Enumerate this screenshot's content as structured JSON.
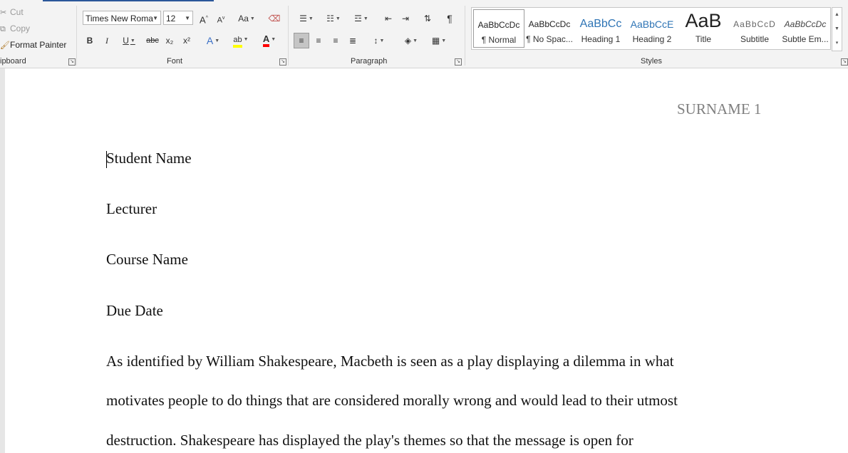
{
  "colors": {
    "accent": "#2b579a",
    "ribbon_bg": "#f3f3f3",
    "heading_blue": "#2e74b5",
    "highlight": "#ffff00",
    "font_color": "#ff0000"
  },
  "clipboard": {
    "cut": "Cut",
    "copy": "Copy",
    "format_painter": "Format Painter",
    "label": "ipboard"
  },
  "font": {
    "name": "Times New Roma",
    "size": "12",
    "label": "Font",
    "grow": "A",
    "shrink": "A",
    "change_case": "Aa",
    "bold": "B",
    "italic": "I",
    "underline": "U",
    "strike": "abc",
    "subscript": "x₂",
    "superscript": "x²",
    "text_effects": "A",
    "highlight": "ab",
    "font_color": "A"
  },
  "paragraph": {
    "label": "Paragraph",
    "show_marks": "¶"
  },
  "styles": {
    "label": "Styles",
    "items": [
      {
        "preview": "AaBbCcDc",
        "name": "¶ Normal"
      },
      {
        "preview": "AaBbCcDc",
        "name": "¶ No Spac..."
      },
      {
        "preview": "AaBbCc",
        "name": "Heading 1"
      },
      {
        "preview": "AaBbCcE",
        "name": "Heading 2"
      },
      {
        "preview": "AaB",
        "name": "Title"
      },
      {
        "preview": "AaBbCcD",
        "name": "Subtitle"
      },
      {
        "preview": "AaBbCcDc",
        "name": "Subtle Em..."
      }
    ]
  },
  "document": {
    "header": "SURNAME 1",
    "lines": [
      "Student Name",
      "Lecturer",
      "Course Name",
      "Due Date",
      "As identified by William Shakespeare, Macbeth is seen as a play displaying a dilemma in what",
      "motivates people to do things that are considered morally wrong and would lead to their utmost",
      "destruction. Shakespeare has displayed the play's themes so that the message is open for"
    ]
  }
}
